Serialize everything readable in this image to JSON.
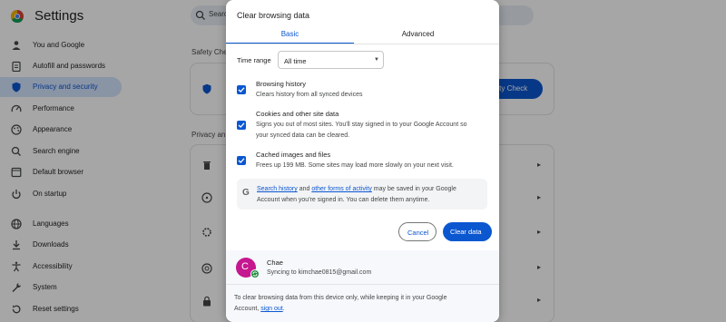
{
  "app": {
    "title": "Settings",
    "search_placeholder": "Search"
  },
  "sidebar": {
    "items": [
      {
        "label": "You and Google",
        "icon": "person-icon"
      },
      {
        "label": "Autofill and passwords",
        "icon": "clipboard-icon"
      },
      {
        "label": "Privacy and security",
        "icon": "shield-icon",
        "active": true
      },
      {
        "label": "Performance",
        "icon": "speedometer-icon"
      },
      {
        "label": "Appearance",
        "icon": "palette-icon"
      },
      {
        "label": "Search engine",
        "icon": "search-icon"
      },
      {
        "label": "Default browser",
        "icon": "browser-icon"
      },
      {
        "label": "On startup",
        "icon": "power-icon"
      },
      {
        "label": "Languages",
        "icon": "globe-icon"
      },
      {
        "label": "Downloads",
        "icon": "download-icon"
      },
      {
        "label": "Accessibility",
        "icon": "accessibility-icon"
      },
      {
        "label": "System",
        "icon": "wrench-icon"
      },
      {
        "label": "Reset settings",
        "icon": "reset-icon"
      }
    ]
  },
  "main": {
    "safety_check_label": "Safety Che",
    "privacy_label": "Privacy an",
    "safety_check_button": "afety Check"
  },
  "dialog": {
    "title": "Clear browsing data",
    "tabs": [
      "Basic",
      "Advanced"
    ],
    "time_range": {
      "label": "Time range",
      "value": "All time"
    },
    "options": [
      {
        "title": "Browsing history",
        "desc": [
          "Clears history from all synced devices"
        ],
        "checked": true
      },
      {
        "title": "Cookies and other site data",
        "desc": [
          "Signs you out of most sites. You'll stay signed in to your Google Account so",
          "your synced data can be cleared."
        ],
        "checked": true
      },
      {
        "title": "Cached images and files",
        "desc": [
          "Frees up 199 MB. Some sites may load more slowly on your next visit."
        ],
        "checked": true
      }
    ],
    "info": {
      "link1": "Search history",
      "mid1": " and ",
      "link2": "other forms of activity",
      "end1": " may be saved in your Google",
      "line2": "Account when you're signed in. You can delete them anytime."
    },
    "cancel_label": "Cancel",
    "clear_label": "Clear data",
    "account": {
      "initial": "C",
      "name": "Chae",
      "sync": "Syncing to kimchae0815@gmail.com"
    },
    "footer": {
      "line1": "To clear browsing data from this device only, while keeping it in your Google",
      "line2_prefix": "Account, ",
      "link": "sign out",
      "line2_suffix": "."
    }
  },
  "colors": {
    "accent": "#0b57d0",
    "overlay": "rgba(0,0,0,0.35)",
    "avatar": "#c5178f",
    "sync_badge": "#1e8e3e"
  }
}
